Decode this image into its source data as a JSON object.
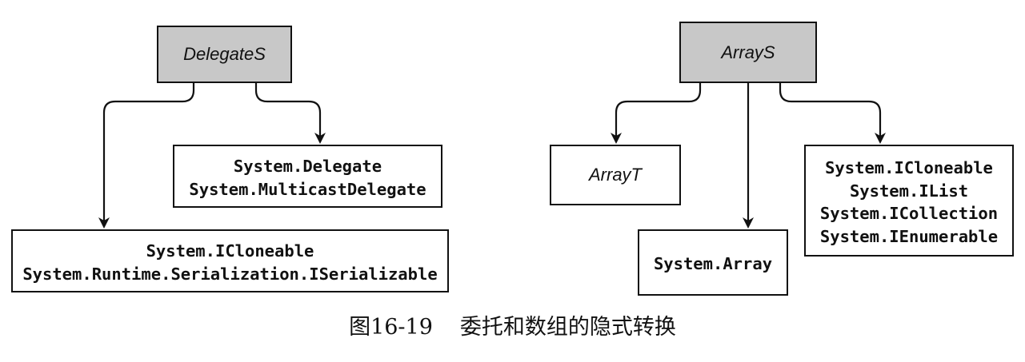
{
  "delegates": {
    "source": "DelegateS",
    "base_types": [
      "System.Delegate",
      "System.MulticastDelegate"
    ],
    "interfaces": [
      "System.ICloneable",
      "System.Runtime.Serialization.ISerializable"
    ]
  },
  "arrays": {
    "source": "ArrayS",
    "target_array": "ArrayT",
    "base_type": "System.Array",
    "interfaces": [
      "System.ICloneable",
      "System.IList",
      "System.ICollection",
      "System.IEnumerable"
    ]
  },
  "caption": {
    "figure_number": "图16-19",
    "title": "委托和数组的隐式转换"
  },
  "colors": {
    "source_fill": "#c8c8c8",
    "ink": "#111111",
    "background": "#ffffff"
  }
}
